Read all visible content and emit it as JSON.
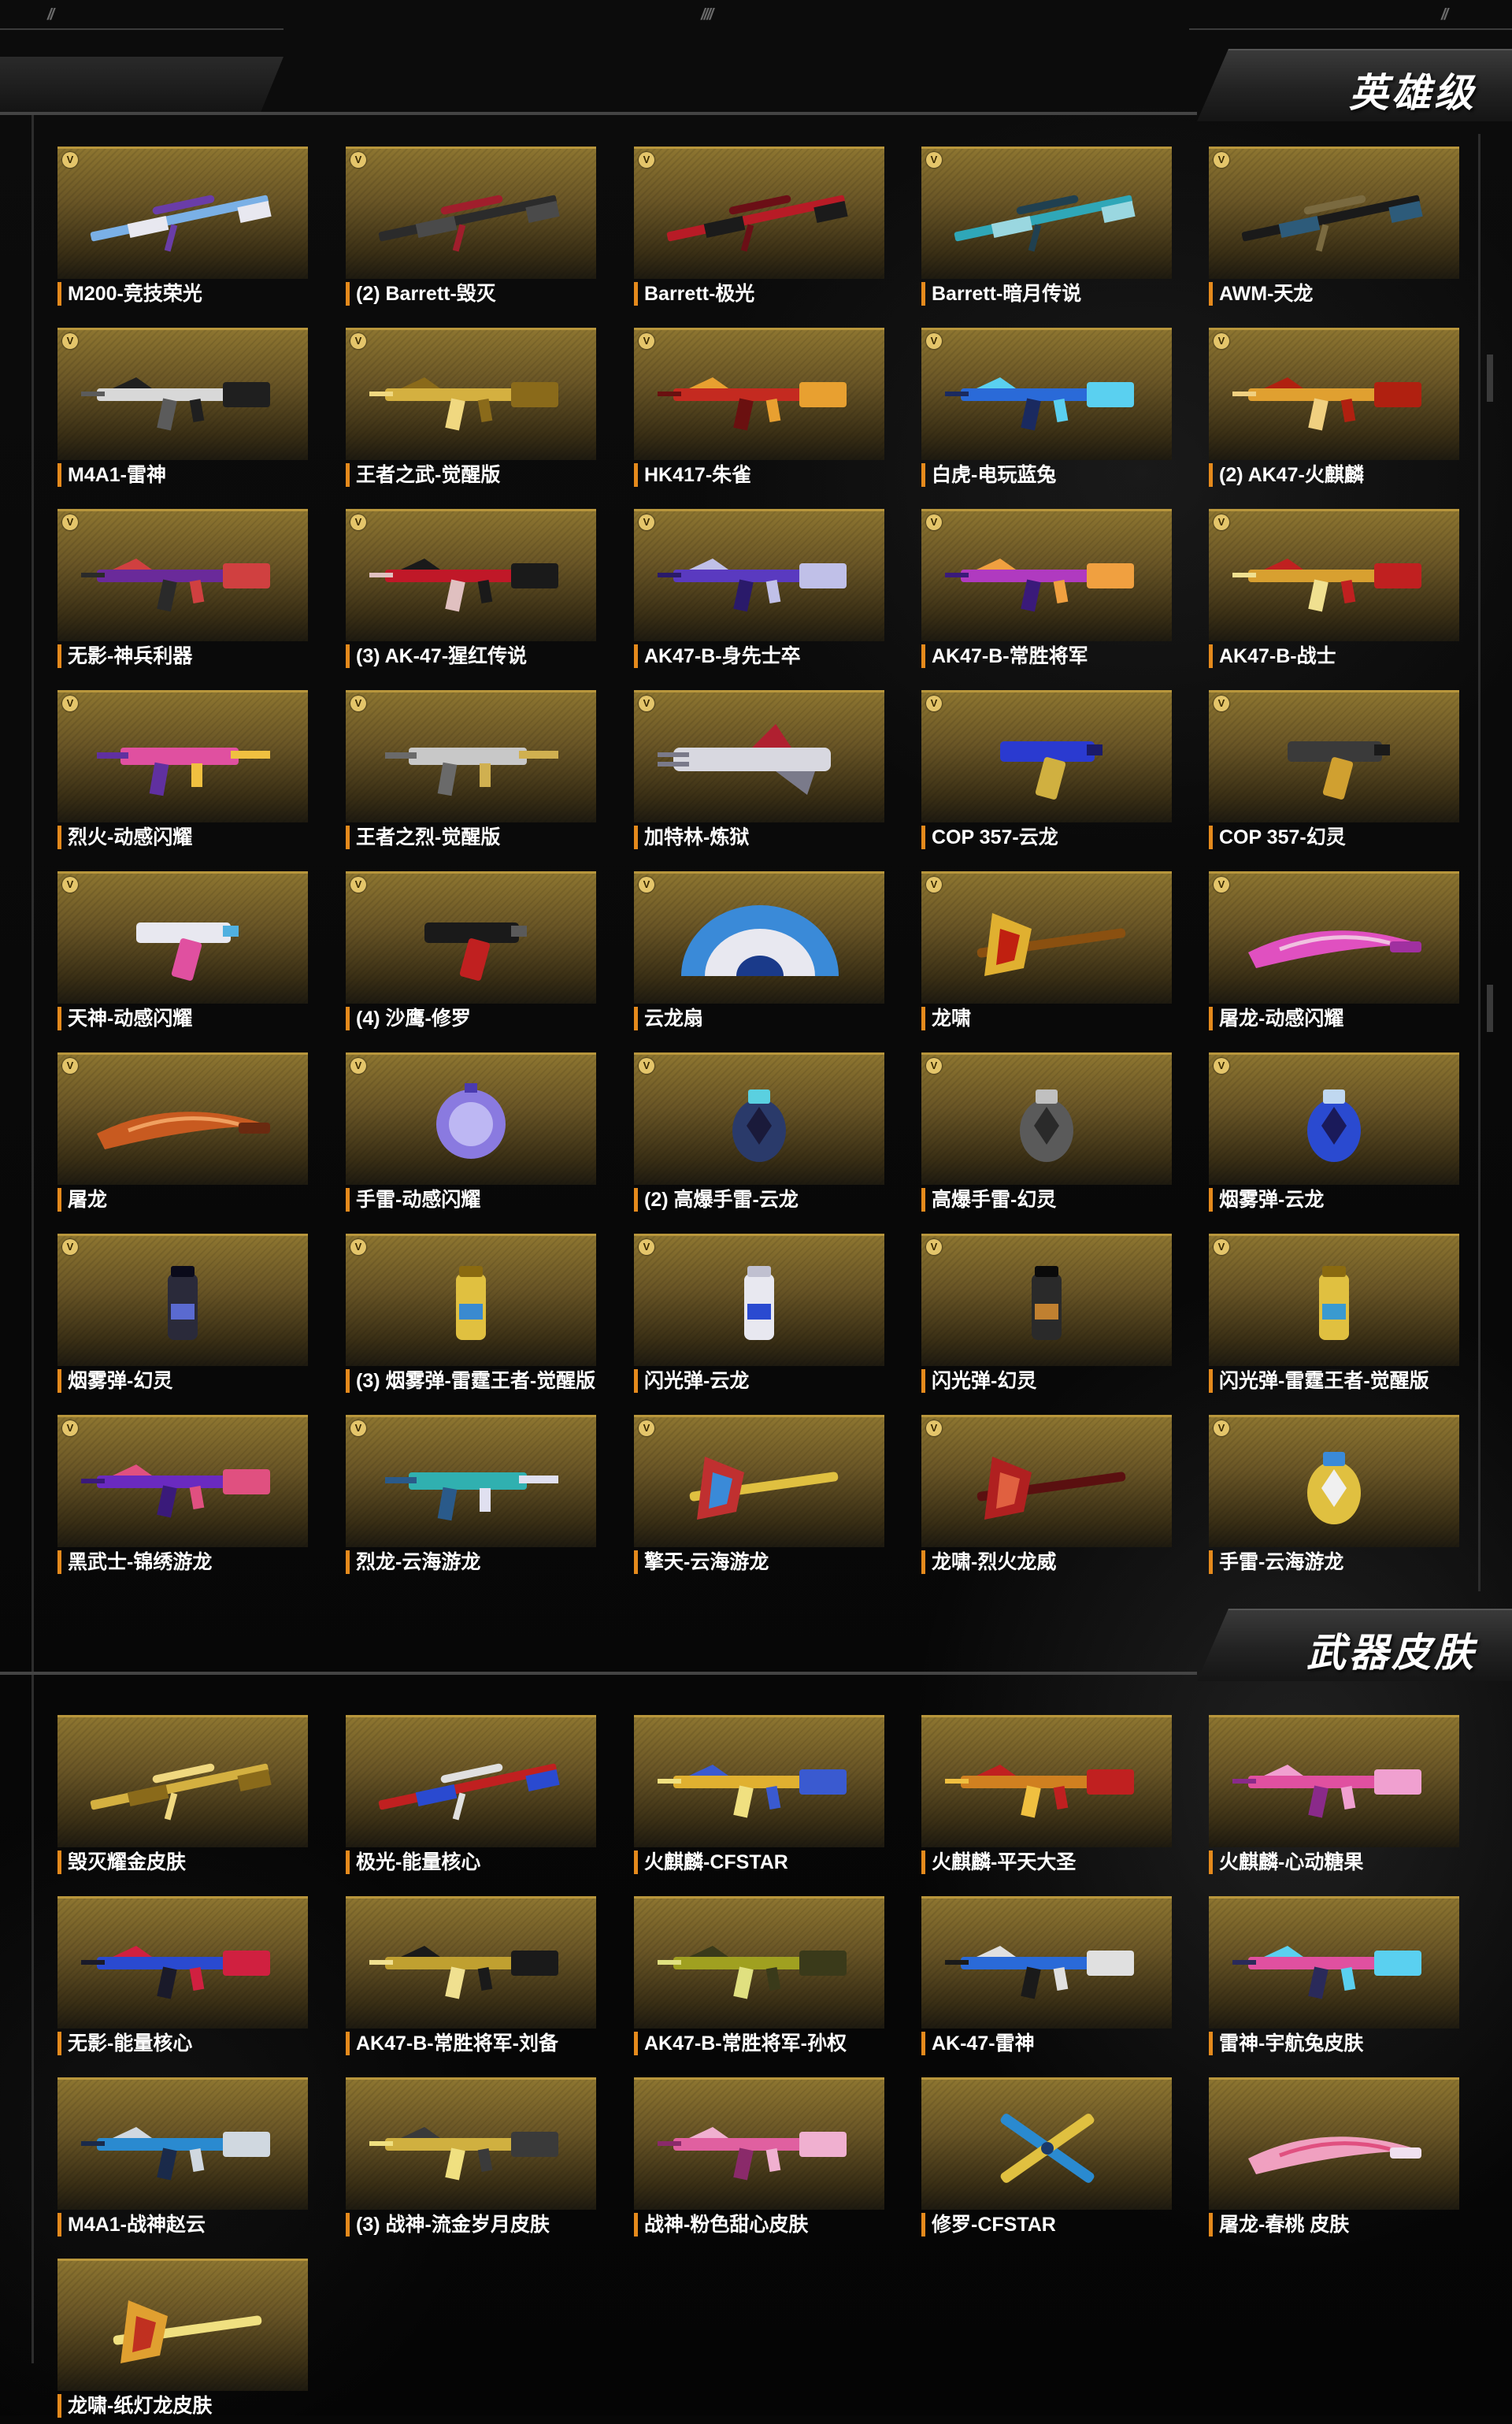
{
  "header_marks": {
    "left": "//",
    "center": "////",
    "right": "//"
  },
  "sections": [
    {
      "title": "英雄级",
      "items": [
        {
          "label": "M200-竞技荣光",
          "kind": "sniper",
          "colors": [
            "#7ab0e6",
            "#e8e8f0",
            "#6a3da8"
          ]
        },
        {
          "label": "(2) Barrett-毁灭",
          "kind": "sniper",
          "colors": [
            "#2b2b2b",
            "#4a4a4a",
            "#a01e2c"
          ]
        },
        {
          "label": "Barrett-极光",
          "kind": "sniper",
          "colors": [
            "#b81b26",
            "#1b1b1b",
            "#6b0f16"
          ]
        },
        {
          "label": "Barrett-暗月传说",
          "kind": "sniper",
          "colors": [
            "#2fa7b8",
            "#9ad7e0",
            "#204050"
          ]
        },
        {
          "label": "AWM-天龙",
          "kind": "sniper",
          "colors": [
            "#1a1a1a",
            "#2d5b7a",
            "#7a6a40"
          ]
        },
        {
          "label": "M4A1-雷神",
          "kind": "rifle",
          "colors": [
            "#d8d8d8",
            "#1f1f1f",
            "#5b5b5b"
          ]
        },
        {
          "label": "王者之武-觉醒版",
          "kind": "rifle",
          "colors": [
            "#d4b040",
            "#8a6a1a",
            "#f0d880"
          ]
        },
        {
          "label": "HK417-朱雀",
          "kind": "rifle",
          "colors": [
            "#c42a20",
            "#e8a030",
            "#6a1010"
          ]
        },
        {
          "label": "白虎-电玩蓝兔",
          "kind": "rifle",
          "colors": [
            "#2a6ad8",
            "#5ad0f0",
            "#1a2a60"
          ]
        },
        {
          "label": "(2) AK47-火麒麟",
          "kind": "rifle",
          "colors": [
            "#e0a030",
            "#b02010",
            "#f0d080"
          ]
        },
        {
          "label": "无影-神兵利器",
          "kind": "rifle",
          "colors": [
            "#6a2a9a",
            "#d04040",
            "#2a2a2a"
          ]
        },
        {
          "label": "(3) AK-47-猩红传说",
          "kind": "rifle",
          "colors": [
            "#c01828",
            "#1a1a1a",
            "#e0c0c0"
          ]
        },
        {
          "label": "AK47-B-身先士卒",
          "kind": "rifle",
          "colors": [
            "#5a3ac0",
            "#c0c0e8",
            "#2a1a6a"
          ]
        },
        {
          "label": "AK47-B-常胜将军",
          "kind": "rifle",
          "colors": [
            "#b03ac0",
            "#f0a040",
            "#3a1a7a"
          ]
        },
        {
          "label": "AK47-B-战士",
          "kind": "rifle",
          "colors": [
            "#d8a030",
            "#c02020",
            "#f0e090"
          ]
        },
        {
          "label": "烈火-动感闪耀",
          "kind": "smg",
          "colors": [
            "#e050a0",
            "#f0c040",
            "#6030a0"
          ]
        },
        {
          "label": "王者之烈-觉醒版",
          "kind": "smg",
          "colors": [
            "#c8c8c8",
            "#d0b050",
            "#6a6a6a"
          ]
        },
        {
          "label": "加特林-炼狱",
          "kind": "gatling",
          "colors": [
            "#d8d8e0",
            "#7a7a8a",
            "#b02030"
          ]
        },
        {
          "label": "COP 357-云龙",
          "kind": "pistol",
          "colors": [
            "#2a3ad0",
            "#d0b040",
            "#1a1a6a"
          ]
        },
        {
          "label": "COP 357-幻灵",
          "kind": "pistol",
          "colors": [
            "#3a3a3a",
            "#d0a030",
            "#1a1a1a"
          ]
        },
        {
          "label": "天神-动感闪耀",
          "kind": "pistol",
          "colors": [
            "#e8e8f0",
            "#e050a0",
            "#50b0e0"
          ]
        },
        {
          "label": "(4) 沙鹰-修罗",
          "kind": "pistol",
          "colors": [
            "#1a1a1a",
            "#c02020",
            "#5a5a5a"
          ]
        },
        {
          "label": "云龙扇",
          "kind": "fan",
          "colors": [
            "#3a8ad8",
            "#e8e8f0",
            "#1a3a8a"
          ]
        },
        {
          "label": "龙啸",
          "kind": "axe",
          "colors": [
            "#e0b030",
            "#c02010",
            "#8a5010"
          ]
        },
        {
          "label": "屠龙-动感闪耀",
          "kind": "knife",
          "colors": [
            "#e050c0",
            "#f0c0e0",
            "#a030a0"
          ]
        },
        {
          "label": "屠龙",
          "kind": "knife",
          "colors": [
            "#c85a20",
            "#f0a060",
            "#6a2a10"
          ]
        },
        {
          "label": "手雷-动感闪耀",
          "kind": "ball",
          "colors": [
            "#8a7ae0",
            "#e0e0ff",
            "#4a3ab0"
          ]
        },
        {
          "label": "(2) 高爆手雷-云龙",
          "kind": "grenade",
          "colors": [
            "#2a3a6a",
            "#5ad0e0",
            "#1a1a3a"
          ]
        },
        {
          "label": "高爆手雷-幻灵",
          "kind": "grenade",
          "colors": [
            "#5a5a5a",
            "#c0c0c0",
            "#2a2a2a"
          ]
        },
        {
          "label": "烟雾弹-云龙",
          "kind": "grenade",
          "colors": [
            "#2a4ad0",
            "#c0d8f0",
            "#1a1a5a"
          ]
        },
        {
          "label": "烟雾弹-幻灵",
          "kind": "canister",
          "colors": [
            "#2a2a3a",
            "#5a6ad0",
            "#0a0a1a"
          ]
        },
        {
          "label": "(3) 烟雾弹-雷霆王者-觉醒版",
          "kind": "canister",
          "colors": [
            "#e0c040",
            "#3a8ad0",
            "#8a6a10"
          ]
        },
        {
          "label": "闪光弹-云龙",
          "kind": "canister",
          "colors": [
            "#e8e8f0",
            "#2a4ad0",
            "#c0c0d0"
          ]
        },
        {
          "label": "闪光弹-幻灵",
          "kind": "canister",
          "colors": [
            "#2a2a2a",
            "#c08030",
            "#0a0a0a"
          ]
        },
        {
          "label": "闪光弹-雷霆王者-觉醒版",
          "kind": "canister",
          "colors": [
            "#e0c040",
            "#3a9ad0",
            "#8a6a10"
          ]
        },
        {
          "label": "黑武士-锦绣游龙",
          "kind": "rifle",
          "colors": [
            "#6a2ac0",
            "#e05080",
            "#3a1a7a"
          ]
        },
        {
          "label": "烈龙-云海游龙",
          "kind": "smg",
          "colors": [
            "#30b0b0",
            "#e0e0f0",
            "#2a5a8a"
          ]
        },
        {
          "label": "擎天-云海游龙",
          "kind": "axe",
          "colors": [
            "#c03030",
            "#3a8ad8",
            "#e0c040"
          ]
        },
        {
          "label": "龙啸-烈火龙威",
          "kind": "axe",
          "colors": [
            "#b02020",
            "#e06040",
            "#5a1010"
          ]
        },
        {
          "label": "手雷-云海游龙",
          "kind": "grenade",
          "colors": [
            "#e0c040",
            "#3a8ad8",
            "#f0f0f0"
          ]
        }
      ]
    },
    {
      "title": "武器皮肤",
      "items": [
        {
          "label": "毁灭耀金皮肤",
          "kind": "sniper",
          "colors": [
            "#d4b040",
            "#8a6a1a",
            "#f0d880"
          ]
        },
        {
          "label": "极光-能量核心",
          "kind": "sniper",
          "colors": [
            "#c02020",
            "#2a4ad0",
            "#e0e0e0"
          ]
        },
        {
          "label": "火麒麟-CFSTAR",
          "kind": "rifle",
          "colors": [
            "#e0b030",
            "#3a5ad0",
            "#f0e080"
          ]
        },
        {
          "label": "火麒麟-平天大圣",
          "kind": "rifle",
          "colors": [
            "#d08020",
            "#c02020",
            "#f0c040"
          ]
        },
        {
          "label": "火麒麟-心动糖果",
          "kind": "rifle",
          "colors": [
            "#e050a0",
            "#f0a0d0",
            "#8a2a8a"
          ]
        },
        {
          "label": "无影-能量核心",
          "kind": "rifle",
          "colors": [
            "#2a4ad0",
            "#d02040",
            "#1a1a2a"
          ]
        },
        {
          "label": "AK47-B-常胜将军-刘备",
          "kind": "rifle",
          "colors": [
            "#c0a030",
            "#1a1a1a",
            "#f0e090"
          ]
        },
        {
          "label": "AK47-B-常胜将军-孙权",
          "kind": "rifle",
          "colors": [
            "#a0a020",
            "#3a3a1a",
            "#e0e080"
          ]
        },
        {
          "label": "AK-47-雷神",
          "kind": "rifle",
          "colors": [
            "#2a6ad8",
            "#e0e0e0",
            "#1a1a1a"
          ]
        },
        {
          "label": "雷神-宇航兔皮肤",
          "kind": "rifle",
          "colors": [
            "#e050a0",
            "#5ad0f0",
            "#2a2a5a"
          ]
        },
        {
          "label": "M4A1-战神赵云",
          "kind": "rifle",
          "colors": [
            "#2a8ad0",
            "#d0d8e0",
            "#1a2a4a"
          ]
        },
        {
          "label": "(3) 战神-流金岁月皮肤",
          "kind": "rifle",
          "colors": [
            "#d0b040",
            "#3a3a3a",
            "#f0e080"
          ]
        },
        {
          "label": "战神-粉色甜心皮肤",
          "kind": "rifle",
          "colors": [
            "#e060a0",
            "#f0b0d0",
            "#8a2a6a"
          ]
        },
        {
          "label": "修罗-CFSTAR",
          "kind": "cross",
          "colors": [
            "#2a8ad0",
            "#e0c040",
            "#1a3a6a"
          ]
        },
        {
          "label": "屠龙-春桃 皮肤",
          "kind": "knife",
          "colors": [
            "#f0a0c0",
            "#e05080",
            "#f0e0f0"
          ]
        },
        {
          "label": "龙啸-纸灯龙皮肤",
          "kind": "axe",
          "colors": [
            "#e0a030",
            "#c03020",
            "#f0e080"
          ]
        }
      ]
    }
  ]
}
